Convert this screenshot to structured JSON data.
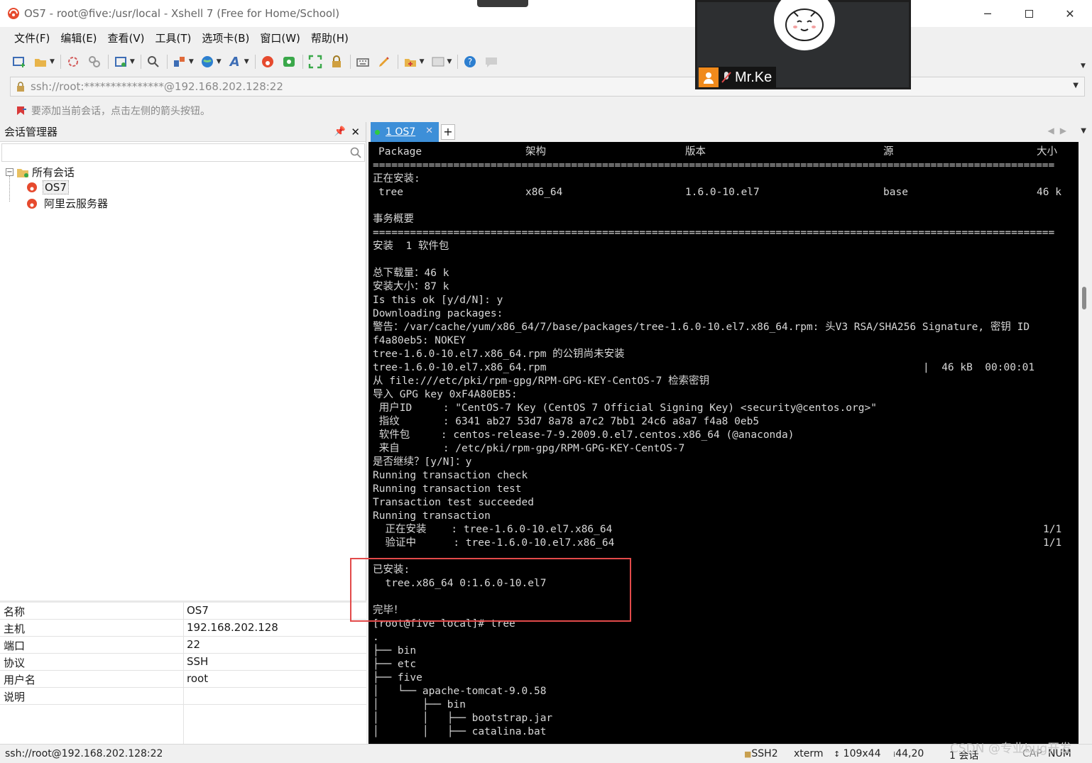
{
  "window": {
    "title": "OS7 - root@five:/usr/local - Xshell 7 (Free for Home/School)"
  },
  "menu": [
    "文件(F)",
    "编辑(E)",
    "查看(V)",
    "工具(T)",
    "选项卡(B)",
    "窗口(W)",
    "帮助(H)"
  ],
  "address": "ssh://root:***************@192.168.202.128:22",
  "hint": "要添加当前会话，点击左侧的箭头按钮。",
  "session_manager": {
    "title": "会话管理器",
    "tree": {
      "root": "所有会话",
      "children": [
        "OS7",
        "阿里云服务器"
      ]
    },
    "props": [
      {
        "key": "名称",
        "value": "OS7"
      },
      {
        "key": "主机",
        "value": "192.168.202.128"
      },
      {
        "key": "端口",
        "value": "22"
      },
      {
        "key": "协议",
        "value": "SSH"
      },
      {
        "key": "用户名",
        "value": "root"
      },
      {
        "key": "说明",
        "value": ""
      }
    ]
  },
  "tabs": [
    {
      "label": "1 OS7"
    }
  ],
  "terminal": {
    "header": [
      "Package",
      "架构",
      "版本",
      "源",
      "大小"
    ],
    "lines": [
      "==============================================================================================================",
      "正在安装:",
      "",
      "",
      "事务概要",
      "==============================================================================================================",
      "安装  1 软件包",
      "",
      "总下载量：46 k",
      "安装大小：87 k",
      "Is this ok [y/d/N]: y",
      "Downloading packages:",
      "警告：/var/cache/yum/x86_64/7/base/packages/tree-1.6.0-10.el7.x86_64.rpm: 头V3 RSA/SHA256 Signature, 密钥 ID",
      "f4a80eb5: NOKEY",
      "tree-1.6.0-10.el7.x86_64.rpm 的公钥尚未安装",
      "",
      "从 file:///etc/pki/rpm-gpg/RPM-GPG-KEY-CentOS-7 检索密钥",
      "导入 GPG key 0xF4A80EB5:",
      " 用户ID     : \"CentOS-7 Key (CentOS 7 Official Signing Key) <security@centos.org>\"",
      " 指纹       : 6341 ab27 53d7 8a78 a7c2 7bb1 24c6 a8a7 f4a8 0eb5",
      " 软件包     : centos-release-7-9.2009.0.el7.centos.x86_64 (@anaconda)",
      " 来自       : /etc/pki/rpm-gpg/RPM-GPG-KEY-CentOS-7",
      "是否继续？[y/N]：y",
      "Running transaction check",
      "Running transaction test",
      "Transaction test succeeded",
      "Running transaction",
      "",
      "",
      "",
      "已安装:",
      "  tree.x86_64 0:1.6.0-10.el7",
      "",
      "完毕！",
      "[root@five local]# tree",
      ".",
      "├── bin",
      "├── etc",
      "├── five",
      "│   └── apache-tomcat-9.0.58",
      "│       ├── bin",
      "│       │   ├── bootstrap.jar",
      "│       │   ├── catalina.bat"
    ],
    "install_row": [
      "tree",
      "x86_64",
      "1.6.0-10.el7",
      "base",
      "46 k"
    ],
    "download_row": [
      "tree-1.6.0-10.el7.x86_64.rpm",
      "|  46 kB  00:00:01"
    ],
    "tx_rows": [
      [
        "  正在安装    : tree-1.6.0-10.el7.x86_64",
        "1/1"
      ],
      [
        "  验证中      : tree-1.6.0-10.el7.x86_64",
        "1/1"
      ]
    ]
  },
  "video": {
    "name": "Mr.Ke"
  },
  "status": {
    "connection": "ssh://root@192.168.202.128:22",
    "protocol": "SSH2",
    "term": "xterm",
    "size": "109x44",
    "cursor": "44,20",
    "sessions": "1 会话",
    "cap": "CAP",
    "num": "NUM"
  },
  "watermark": "CSDN @专业bug开发",
  "colors": {
    "accent": "#3d8fd8",
    "highlight": "#e24a4a",
    "terminal_bg": "#000000",
    "terminal_fg": "#d8d8d8"
  }
}
